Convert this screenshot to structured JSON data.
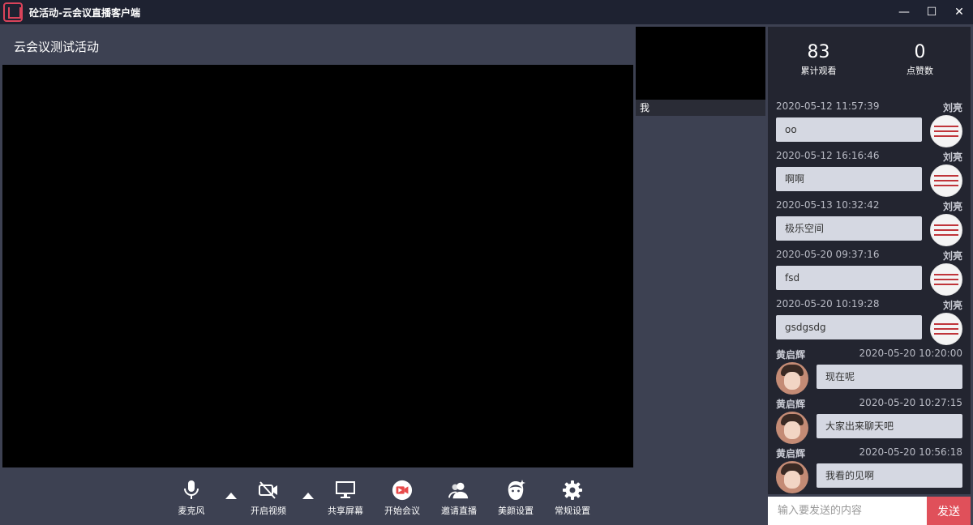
{
  "window": {
    "title": "砼活动-云会议直播客户端",
    "minimize_glyph": "—",
    "maximize_glyph": "☐",
    "close_glyph": "✕"
  },
  "activity": {
    "title": "云会议测试活动"
  },
  "self_preview": {
    "label": "我"
  },
  "stats": {
    "views_count": "83",
    "views_label": "累计观看",
    "likes_count": "0",
    "likes_label": "点赞数"
  },
  "toolbar": {
    "mic_label": "麦克风",
    "video_label": "开启视频",
    "share_label": "共享屏幕",
    "start_label": "开始会议",
    "invite_label": "邀请直播",
    "beauty_label": "美颜设置",
    "settings_label": "常规设置"
  },
  "chat": {
    "messages": [
      {
        "side": "right",
        "time": "2020-05-12 11:57:39",
        "name": "刘亮",
        "text": "oo",
        "avatar": "seal-avatar"
      },
      {
        "side": "right",
        "time": "2020-05-12 16:16:46",
        "name": "刘亮",
        "text": "啊啊",
        "avatar": "seal-avatar"
      },
      {
        "side": "right",
        "time": "2020-05-13 10:32:42",
        "name": "刘亮",
        "text": "极乐空间",
        "avatar": "seal-avatar"
      },
      {
        "side": "right",
        "time": "2020-05-20 09:37:16",
        "name": "刘亮",
        "text": "fsd",
        "avatar": "seal-avatar"
      },
      {
        "side": "right",
        "time": "2020-05-20 10:19:28",
        "name": "刘亮",
        "text": "gsdgsdg",
        "avatar": "seal-avatar"
      },
      {
        "side": "left",
        "time": "2020-05-20 10:20:00",
        "name": "黄启辉",
        "text": "现在呢",
        "avatar": "photo-avatar"
      },
      {
        "side": "left",
        "time": "2020-05-20 10:27:15",
        "name": "黄启辉",
        "text": "大家出来聊天吧",
        "avatar": "photo-avatar"
      },
      {
        "side": "left",
        "time": "2020-05-20 10:56:18",
        "name": "黄启辉",
        "text": "我看的见啊",
        "avatar": "photo-avatar"
      }
    ],
    "input_placeholder": "输入要发送的内容",
    "send_label": "发送"
  },
  "colors": {
    "titlebar_bg": "#1e2231",
    "app_bg": "#3d4152",
    "panel_bg": "#232530",
    "bubble_bg": "#d5d8e2",
    "send_button": "#e0505a",
    "start_meeting_accent": "#e84a4a"
  }
}
